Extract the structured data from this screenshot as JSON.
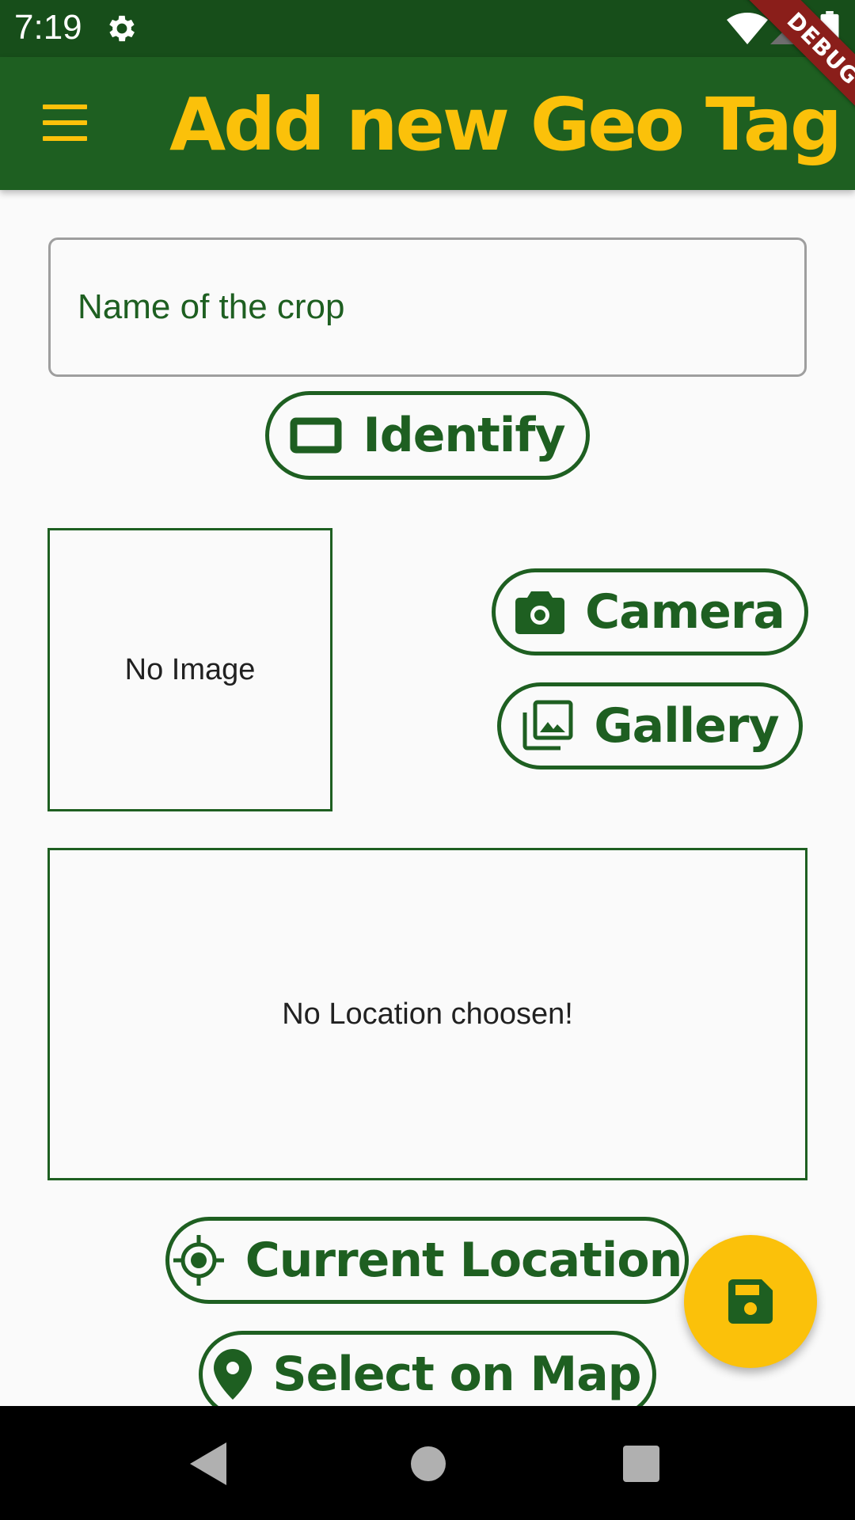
{
  "status_bar": {
    "time": "7:19",
    "icons": [
      "gear-icon",
      "wifi-icon",
      "signal-icon",
      "battery-icon"
    ]
  },
  "debug_banner": "DEBUG",
  "app_bar": {
    "title": "Add new Geo Tag",
    "menu_icon": "menu-icon"
  },
  "form": {
    "crop_name": {
      "placeholder": "Name of the crop",
      "value": ""
    },
    "identify_button": {
      "label": "Identify",
      "icon": "crop-landscape-icon"
    },
    "image_preview": {
      "text": "No Image"
    },
    "camera_button": {
      "label": "Camera",
      "icon": "camera-icon"
    },
    "gallery_button": {
      "label": "Gallery",
      "icon": "photo-library-icon"
    },
    "location_preview": {
      "text": "No Location choosen!"
    },
    "current_location_button": {
      "label": "Current Location",
      "icon": "gps-fixed-icon"
    },
    "select_map_button": {
      "label": "Select on Map",
      "icon": "location-pin-icon"
    }
  },
  "fab": {
    "icon": "save-icon"
  },
  "nav_bar": {
    "icons": [
      "back-icon",
      "home-icon",
      "recents-icon"
    ]
  },
  "colors": {
    "primary": "#1e5f21",
    "status_bar": "#174e1a",
    "accent": "#fbc10a",
    "background": "#fafafa",
    "debug": "#8a1e1a"
  }
}
